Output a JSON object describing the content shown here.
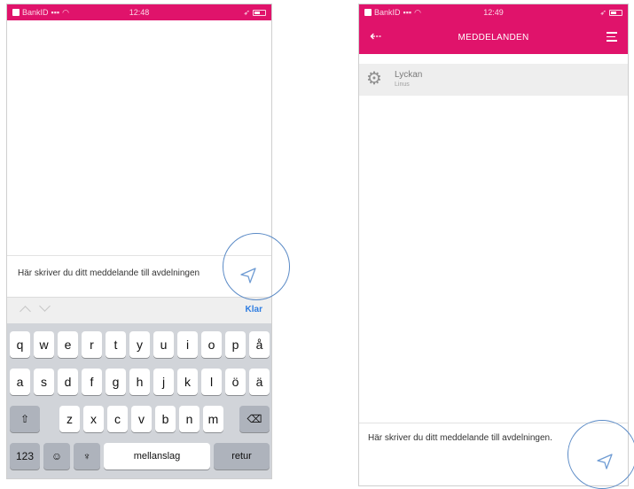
{
  "left_screen": {
    "status_bar": {
      "carrier": "BankID",
      "time": "12:48"
    },
    "compose": {
      "text": "Här skriver du ditt meddelande till avdelningen"
    },
    "accessory_bar": {
      "done_label": "Klar"
    },
    "keyboard": {
      "row1": [
        "q",
        "w",
        "e",
        "r",
        "t",
        "y",
        "u",
        "i",
        "o",
        "p",
        "å"
      ],
      "row2": [
        "a",
        "s",
        "d",
        "f",
        "g",
        "h",
        "j",
        "k",
        "l",
        "ö",
        "ä"
      ],
      "row3": [
        "z",
        "x",
        "c",
        "v",
        "b",
        "n",
        "m"
      ],
      "numbers_label": "123",
      "space_label": "mellanslag",
      "return_label": "retur"
    }
  },
  "right_screen": {
    "status_bar": {
      "carrier": "BankID",
      "time": "12:49"
    },
    "header": {
      "title": "MEDDELANDEN"
    },
    "channel": {
      "title": "Lyckan",
      "subtitle": "Linus"
    },
    "compose": {
      "text": "Här skriver du ditt meddelande till avdelningen."
    }
  },
  "icons": {
    "send": "paper-plane-icon",
    "back": "back-arrow-icon",
    "menu": "hamburger-menu-icon",
    "gear": "gear-icon",
    "shift": "shift-icon",
    "backspace": "backspace-icon",
    "emoji": "emoji-icon",
    "mic": "microphone-icon"
  },
  "colors": {
    "brand": "#e0136b",
    "link": "#2f7de1",
    "highlight": "#5a8ac6"
  }
}
